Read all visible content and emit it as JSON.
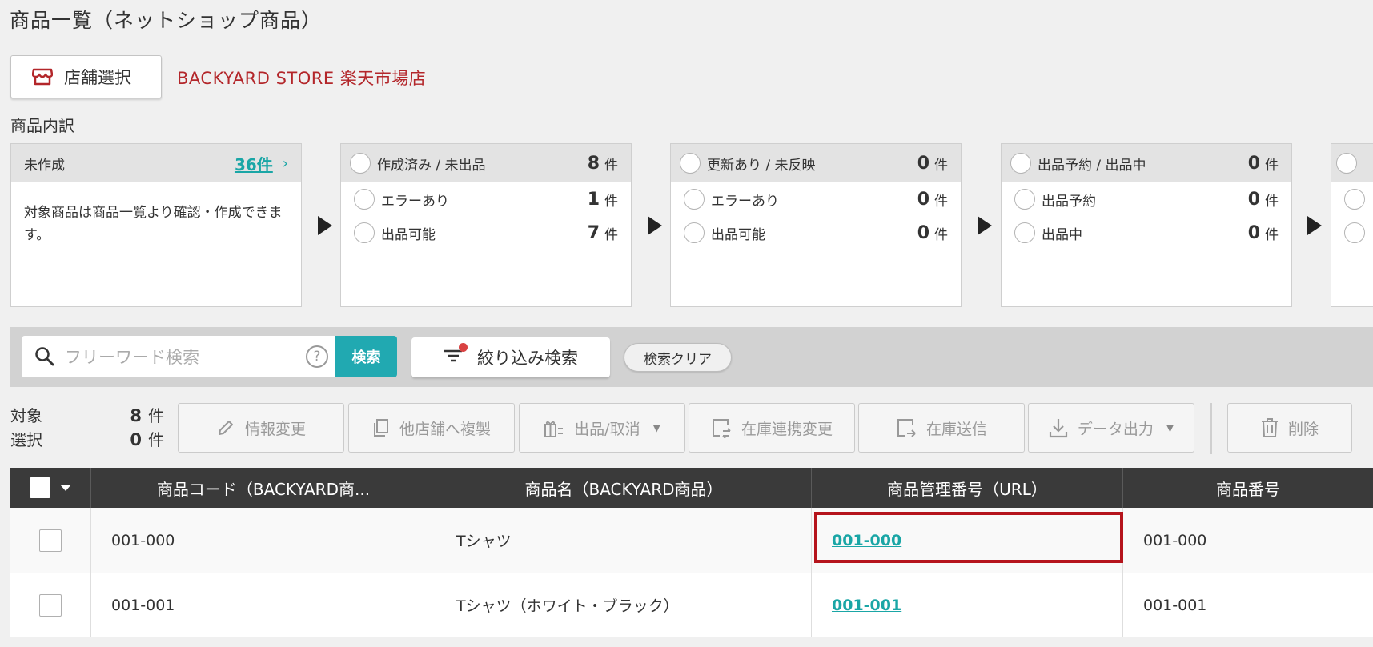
{
  "page": {
    "title": "商品一覧（ネットショップ商品）"
  },
  "store": {
    "button_label": "店舗選択",
    "name": "BACKYARD STORE 楽天市場店"
  },
  "breakdown": {
    "label": "商品内訳",
    "cards": [
      {
        "title": "未作成",
        "count_link": "36件",
        "chevron": "›",
        "description": "対象商品は商品一覧より確認・作成できます。"
      },
      {
        "title": "作成済み / 未出品",
        "count": "8",
        "unit": "件",
        "rows": [
          {
            "label": "エラーあり",
            "count": "1",
            "unit": "件"
          },
          {
            "label": "出品可能",
            "count": "7",
            "unit": "件"
          }
        ]
      },
      {
        "title": "更新あり / 未反映",
        "count": "0",
        "unit": "件",
        "rows": [
          {
            "label": "エラーあり",
            "count": "0",
            "unit": "件"
          },
          {
            "label": "出品可能",
            "count": "0",
            "unit": "件"
          }
        ]
      },
      {
        "title": "出品予約 / 出品中",
        "count": "0",
        "unit": "件",
        "rows": [
          {
            "label": "出品予約",
            "count": "0",
            "unit": "件"
          },
          {
            "label": "出品中",
            "count": "0",
            "unit": "件"
          }
        ]
      }
    ]
  },
  "search": {
    "placeholder": "フリーワード検索",
    "help": "?",
    "button": "検索",
    "filter_button": "絞り込み検索",
    "clear_button": "検索クリア"
  },
  "stats": {
    "target_label": "対象",
    "target_count": "8",
    "selected_label": "選択",
    "selected_count": "0",
    "unit": "件"
  },
  "actions": {
    "edit": "情報変更",
    "copy": "他店舗へ複製",
    "list": "出品/取消",
    "stock_link": "在庫連携変更",
    "stock_send": "在庫送信",
    "export": "データ出力",
    "delete": "削除"
  },
  "table": {
    "headers": [
      "商品コード（BACKYARD商...",
      "商品名（BACKYARD商品）",
      "商品管理番号（URL）",
      "商品番号"
    ],
    "rows": [
      {
        "code": "001-000",
        "name": "Tシャツ",
        "manage_no": "001-000",
        "item_no": "001-000"
      },
      {
        "code": "001-001",
        "name": "Tシャツ（ホワイト・ブラック）",
        "manage_no": "001-001",
        "item_no": "001-001"
      }
    ]
  },
  "colors": {
    "accent": "#21a9b1",
    "store_name": "#b3262a",
    "highlight": "#b5141c",
    "header_bg": "#3a3a3a"
  }
}
